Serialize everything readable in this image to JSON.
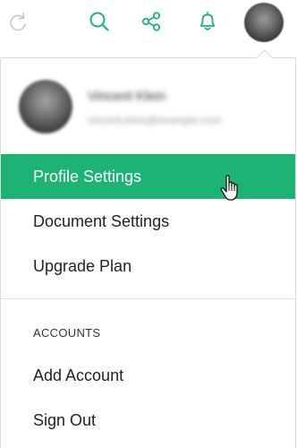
{
  "toolbar": {
    "icons": [
      "redo-icon",
      "search-icon",
      "share-icon",
      "bell-icon"
    ],
    "accent_color": "#1db374",
    "disabled_color": "#c8c8c8"
  },
  "user": {
    "name": "Vincent Klein",
    "email": "vincent.klein@example.com",
    "blurred": true
  },
  "menu": {
    "primary": [
      {
        "label": "Profile Settings",
        "active": true
      },
      {
        "label": "Document Settings",
        "active": false
      },
      {
        "label": "Upgrade Plan",
        "active": false
      }
    ],
    "accounts_heading": "ACCOUNTS",
    "accounts": [
      {
        "label": "Add Account"
      },
      {
        "label": "Sign Out"
      }
    ]
  },
  "colors": {
    "active_background": "#1db374",
    "active_text": "#ffffff",
    "text": "#222222",
    "divider": "#e2e2e2"
  }
}
